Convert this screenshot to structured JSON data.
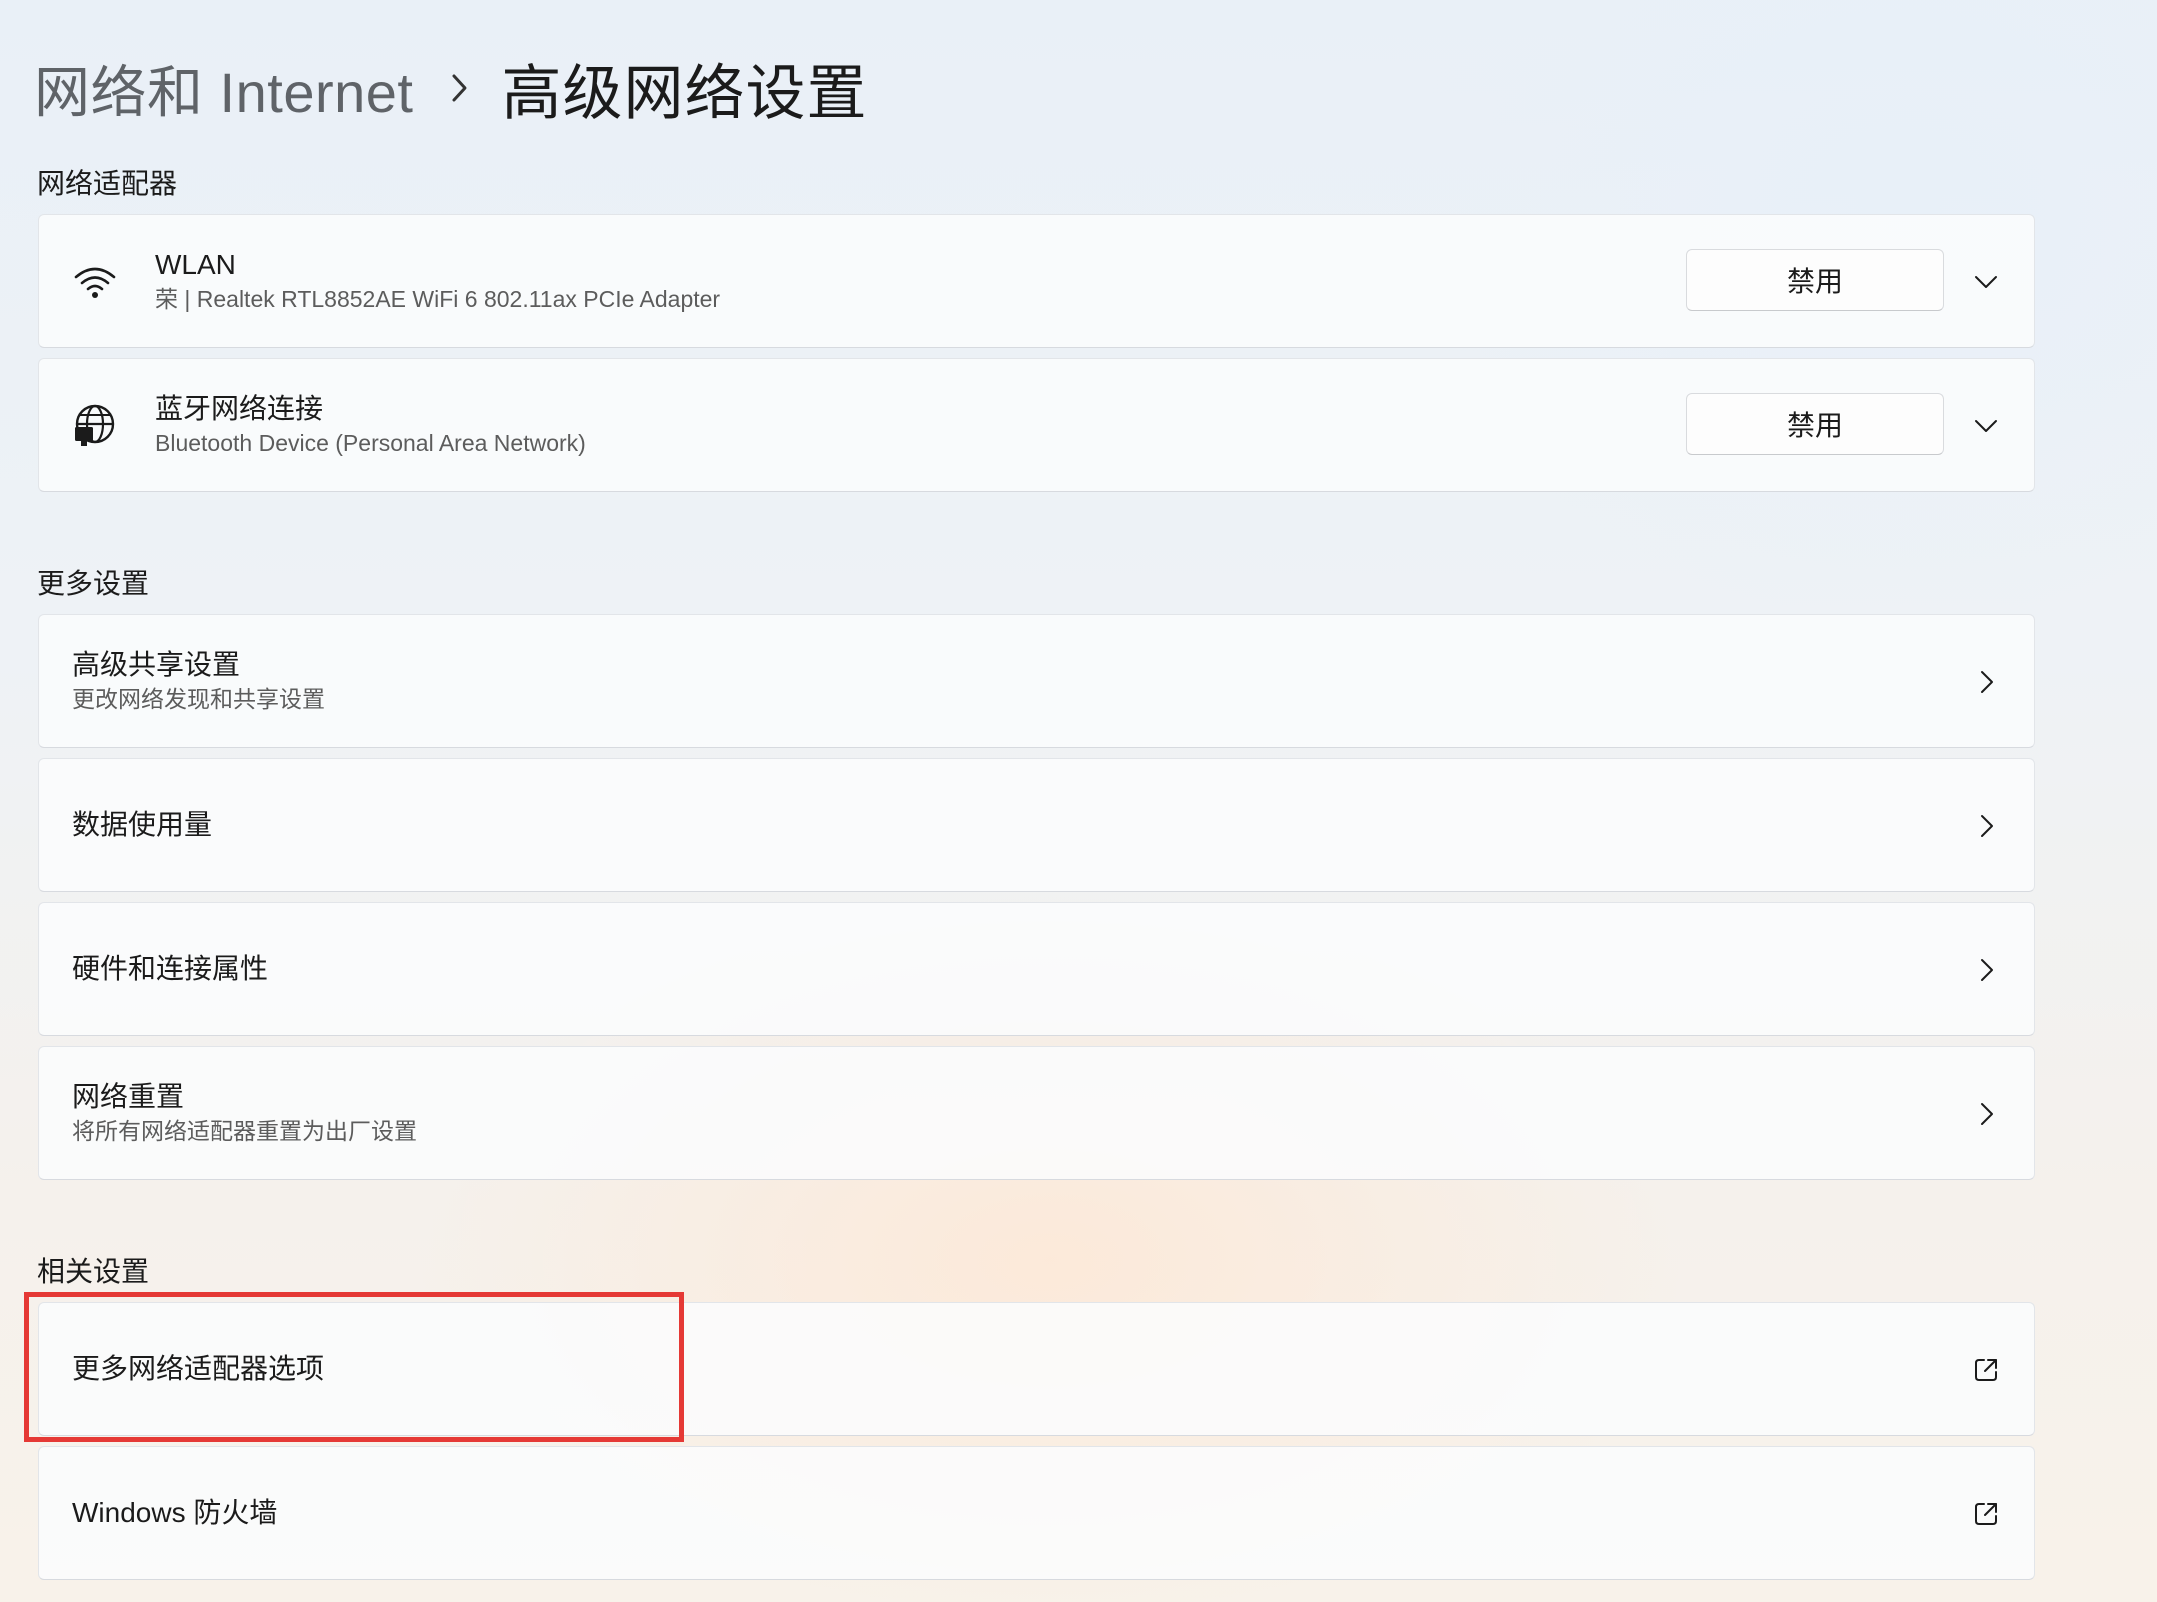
{
  "breadcrumb": {
    "parent": "网络和 Internet",
    "separator_icon": "chevron-right-icon",
    "current": "高级网络设置"
  },
  "sections": {
    "adapters_title": "网络适配器",
    "more_title": "更多设置",
    "related_title": "相关设置"
  },
  "adapters": [
    {
      "icon": "wifi-icon",
      "name": "WLAN",
      "description": "荣 | Realtek RTL8852AE WiFi 6 802.11ax PCIe Adapter",
      "button_label": "禁用",
      "expand_icon": "chevron-down-icon"
    },
    {
      "icon": "ethernet-globe-icon",
      "name": "蓝牙网络连接",
      "description": "Bluetooth Device (Personal Area Network)",
      "button_label": "禁用",
      "expand_icon": "chevron-down-icon"
    }
  ],
  "more_settings": [
    {
      "title": "高级共享设置",
      "subtitle": "更改网络发现和共享设置",
      "icon": "chevron-right-icon"
    },
    {
      "title": "数据使用量",
      "icon": "chevron-right-icon"
    },
    {
      "title": "硬件和连接属性",
      "icon": "chevron-right-icon"
    },
    {
      "title": "网络重置",
      "subtitle": "将所有网络适配器重置为出厂设置",
      "icon": "chevron-right-icon"
    }
  ],
  "related_settings": [
    {
      "title": "更多网络适配器选项",
      "icon": "external-link-icon"
    },
    {
      "title": "Windows 防火墙",
      "icon": "external-link-icon"
    }
  ],
  "highlight_color": "#e53935"
}
